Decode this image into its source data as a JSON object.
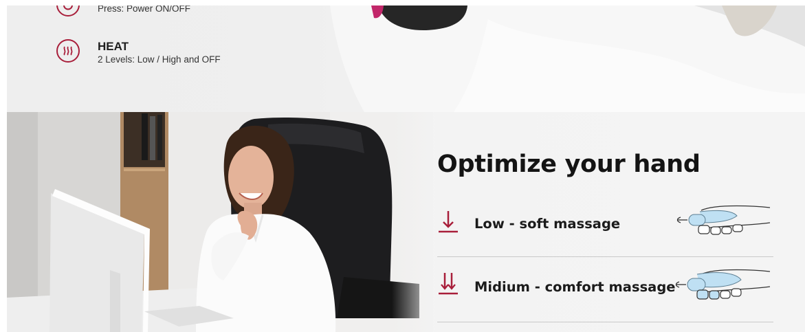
{
  "features": [
    {
      "id": "power",
      "icon": "power-icon",
      "desc": "Press: Power ON/OFF"
    },
    {
      "id": "heat",
      "icon": "heat-waves-icon",
      "title": "HEAT",
      "desc": "2 Levels: Low / High and OFF"
    }
  ],
  "section": {
    "heading": "Optimize your hand",
    "modes": [
      {
        "label": "Low - soft massage",
        "icon": "arrow-down-icon"
      },
      {
        "label": "Midium - comfort massage",
        "icon": "double-arrow-down-icon"
      }
    ]
  },
  "colors": {
    "accent": "#a81e3a",
    "heading_text": "#141414",
    "divider": "#c9c9c9",
    "hand_fill": "#bfe0f3",
    "top_background": "#efefef"
  }
}
